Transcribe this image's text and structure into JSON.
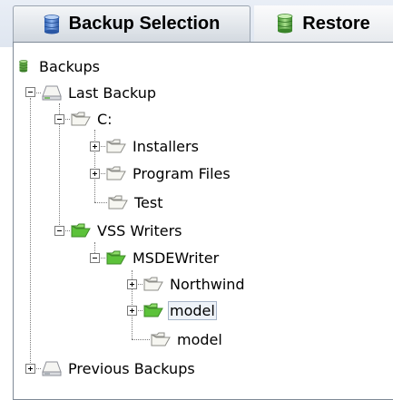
{
  "tabs": {
    "backup_selection": "Backup Selection",
    "restore": "Restore"
  },
  "tree": {
    "backups": "Backups",
    "last_backup": "Last Backup",
    "drive_c": "C:",
    "installers": "Installers",
    "program_files": "Program Files",
    "test": "Test",
    "vss_writers": "VSS Writers",
    "msdewriter": "MSDEWriter",
    "northwind": "Northwind",
    "model_selected": "model",
    "model_leaf": "model",
    "previous_backups": "Previous Backups"
  },
  "colors": {
    "tab_bar": "#e4eaf2",
    "folder_green": "#5cc23a",
    "folder_plain": "#f3f3ee",
    "selection": "#eef2f8"
  }
}
